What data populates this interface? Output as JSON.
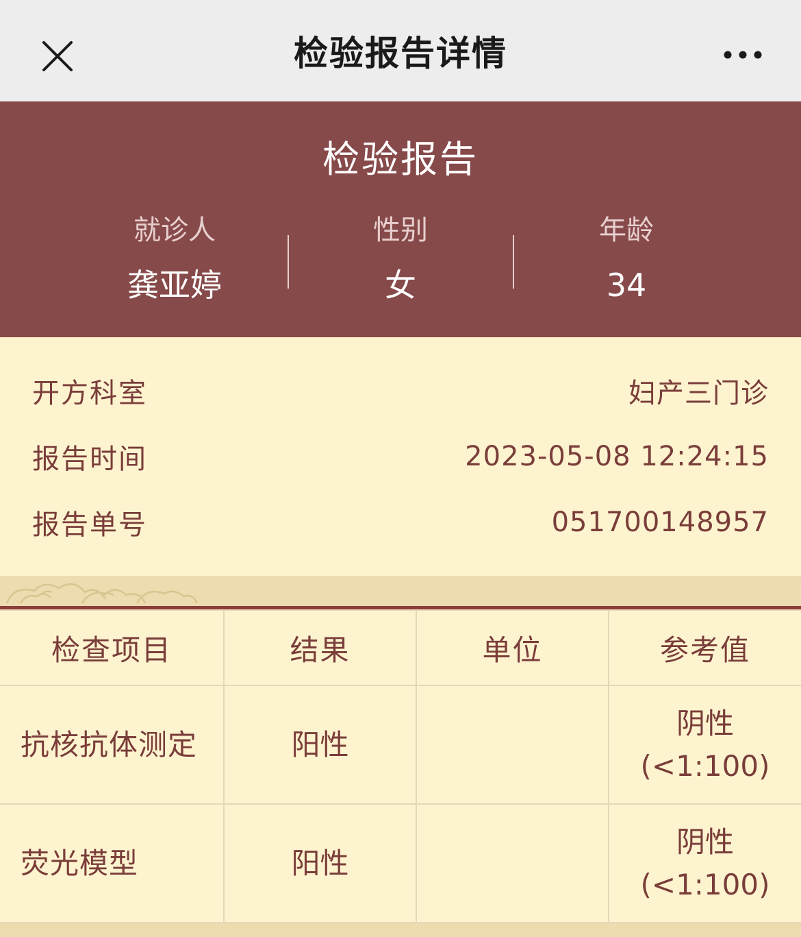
{
  "navbar": {
    "title": "检验报告详情",
    "close_icon": "close-icon",
    "more_icon": "more-icon"
  },
  "header": {
    "title": "检验报告",
    "patient_label": "就诊人",
    "patient_value": "龚亚婷",
    "gender_label": "性别",
    "gender_value": "女",
    "age_label": "年龄",
    "age_value": "34",
    "bg_color": "#874a4a"
  },
  "details": [
    {
      "label": "开方科室",
      "value": "妇产三门诊"
    },
    {
      "label": "报告时间",
      "value": "2023-05-08 12:24:15"
    },
    {
      "label": "报告单号",
      "value": "051700148957"
    }
  ],
  "table": {
    "headers": [
      "检查项目",
      "结果",
      "单位",
      "参考值"
    ],
    "rows": [
      {
        "item": "抗核抗体测定",
        "result": "阳性",
        "unit": "",
        "ref_line1": "阴性",
        "ref_line2": "(<1:100)"
      },
      {
        "item": "荧光模型",
        "result": "阳性",
        "unit": "",
        "ref_line1": "阴性",
        "ref_line2": "(<1:100)"
      }
    ]
  }
}
